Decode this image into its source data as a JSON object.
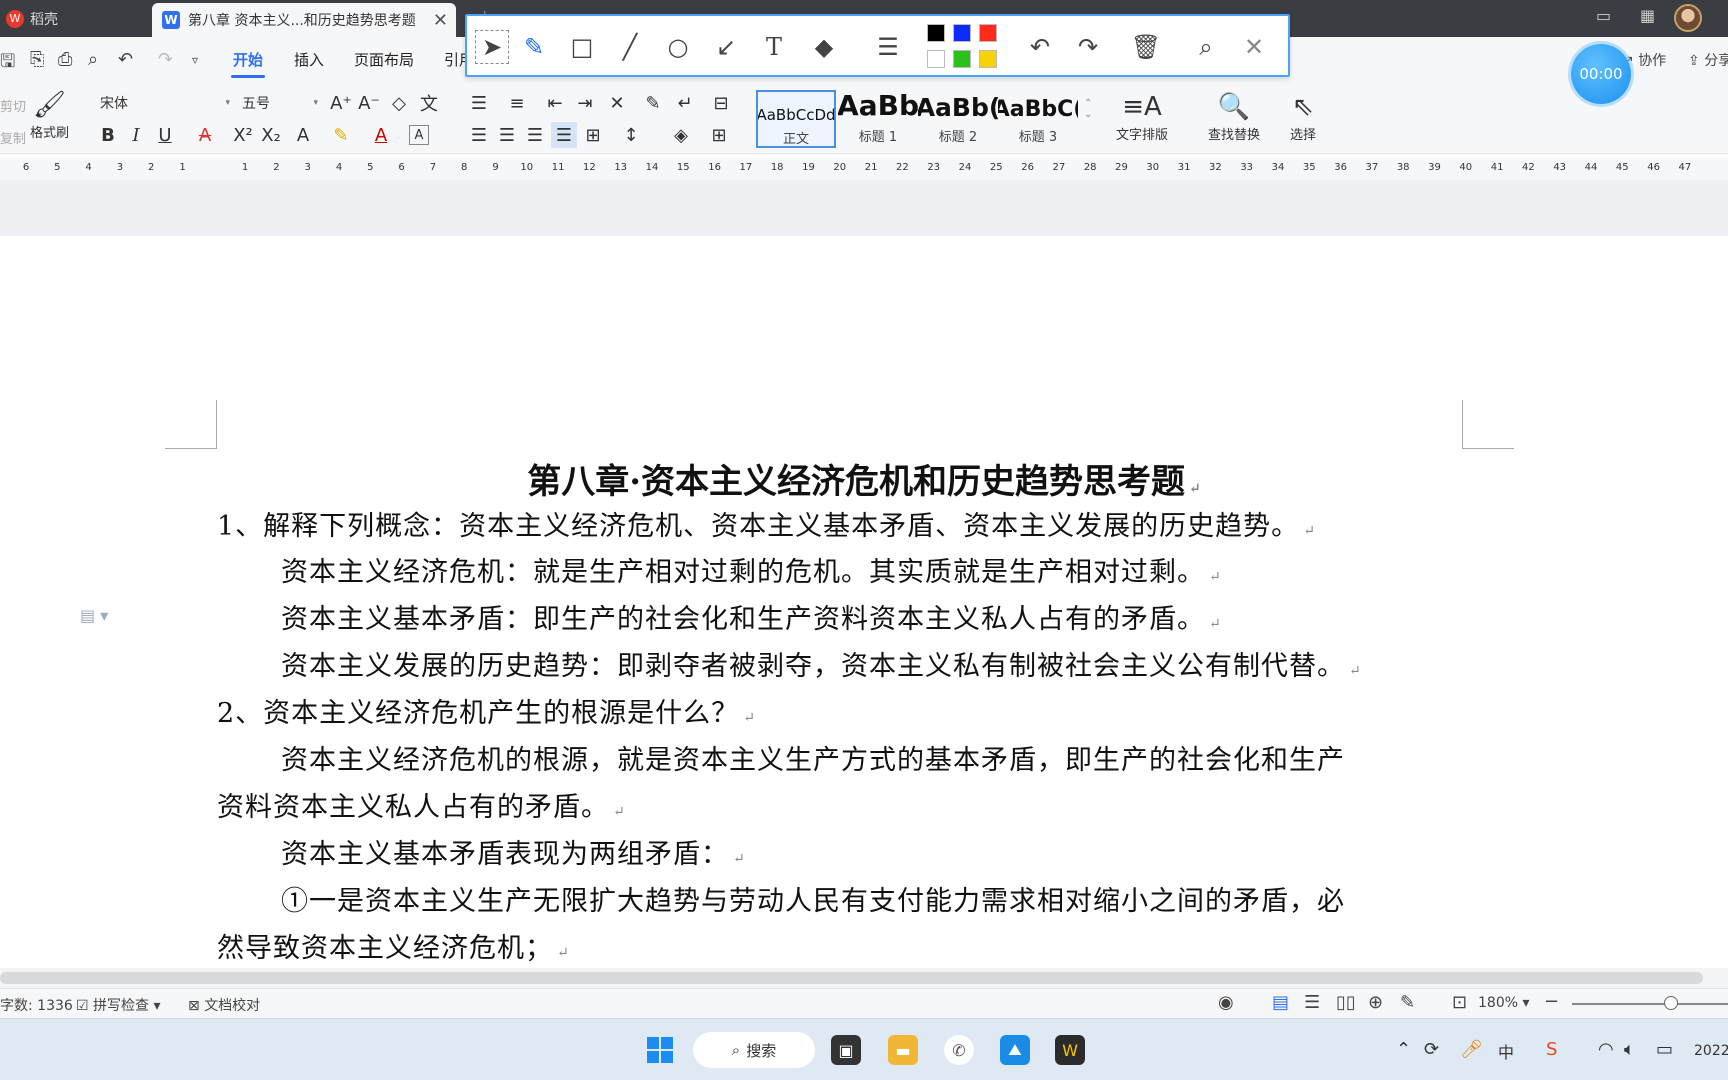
{
  "tabs": {
    "app_label": "稻壳",
    "doc_label": "第八章 资本主义...和历史趋势思考题",
    "close_glyph": "✕"
  },
  "menu": {
    "items": [
      "开始",
      "插入",
      "页面布局",
      "引用"
    ],
    "active": "开始"
  },
  "top_right": {
    "collab": "协作",
    "share": "分享",
    "timer": "00:00"
  },
  "drawbar": {
    "colors": [
      "#000000",
      "#0a2cff",
      "#ff2a1a",
      "#ffffff",
      "#2ac11a",
      "#f5d20a"
    ]
  },
  "ribbon": {
    "cut": "剪切",
    "copy": "复制",
    "format_painter": "格式刷",
    "font_name": "宋体",
    "font_size": "五号",
    "styles": [
      {
        "preview": "AaBbCcDd",
        "name": "正文"
      },
      {
        "preview": "AaBb",
        "name": "标题 1"
      },
      {
        "preview": "AaBb(",
        "name": "标题 2"
      },
      {
        "preview": "AaBbC(",
        "name": "标题 3"
      }
    ],
    "text_layout": "文字排版",
    "find_replace": "查找替换",
    "select": "选择"
  },
  "ruler": {
    "labels": [
      "6",
      "5",
      "4",
      "3",
      "2",
      "1",
      "",
      "1",
      "2",
      "3",
      "4",
      "5",
      "6",
      "7",
      "8",
      "9",
      "10",
      "11",
      "12",
      "13",
      "14",
      "15",
      "16",
      "17",
      "18",
      "19",
      "20",
      "21",
      "22",
      "23",
      "24",
      "25",
      "26",
      "27",
      "28",
      "29",
      "30",
      "31",
      "32",
      "33",
      "34",
      "35",
      "36",
      "37",
      "38",
      "39",
      "40",
      "41",
      "42",
      "43",
      "44",
      "45",
      "46",
      "47"
    ]
  },
  "document": {
    "title": "第八章·资本主义经济危机和历史趋势思考题",
    "lines": [
      "1、解释下列概念：资本主义经济危机、资本主义基本矛盾、资本主义发展的历史趋势。",
      "资本主义经济危机：就是生产相对过剩的危机。其实质就是生产相对过剩。",
      "资本主义基本矛盾：即生产的社会化和生产资料资本主义私人占有的矛盾。",
      "资本主义发展的历史趋势：即剥夺者被剥夺，资本主义私有制被社会主义公有制代替。",
      "2、资本主义经济危机产生的根源是什么？",
      "资本主义经济危机的根源，就是资本主义生产方式的基本矛盾，即生产的社会化和生产",
      "资料资本主义私人占有的矛盾。",
      "资本主义基本矛盾表现为两组矛盾：",
      "①一是资本主义生产无限扩大趋势与劳动人民有支付能力需求相对缩小之间的矛盾，必",
      "然导致资本主义经济危机；"
    ],
    "para_mark": "↵"
  },
  "status": {
    "word_count": "字数: 1336",
    "spell_check": "拼写检查",
    "doc_proof": "文档校对",
    "zoom": "180%"
  },
  "taskbar": {
    "search": "搜索",
    "year": "2022",
    "ime": "中"
  }
}
